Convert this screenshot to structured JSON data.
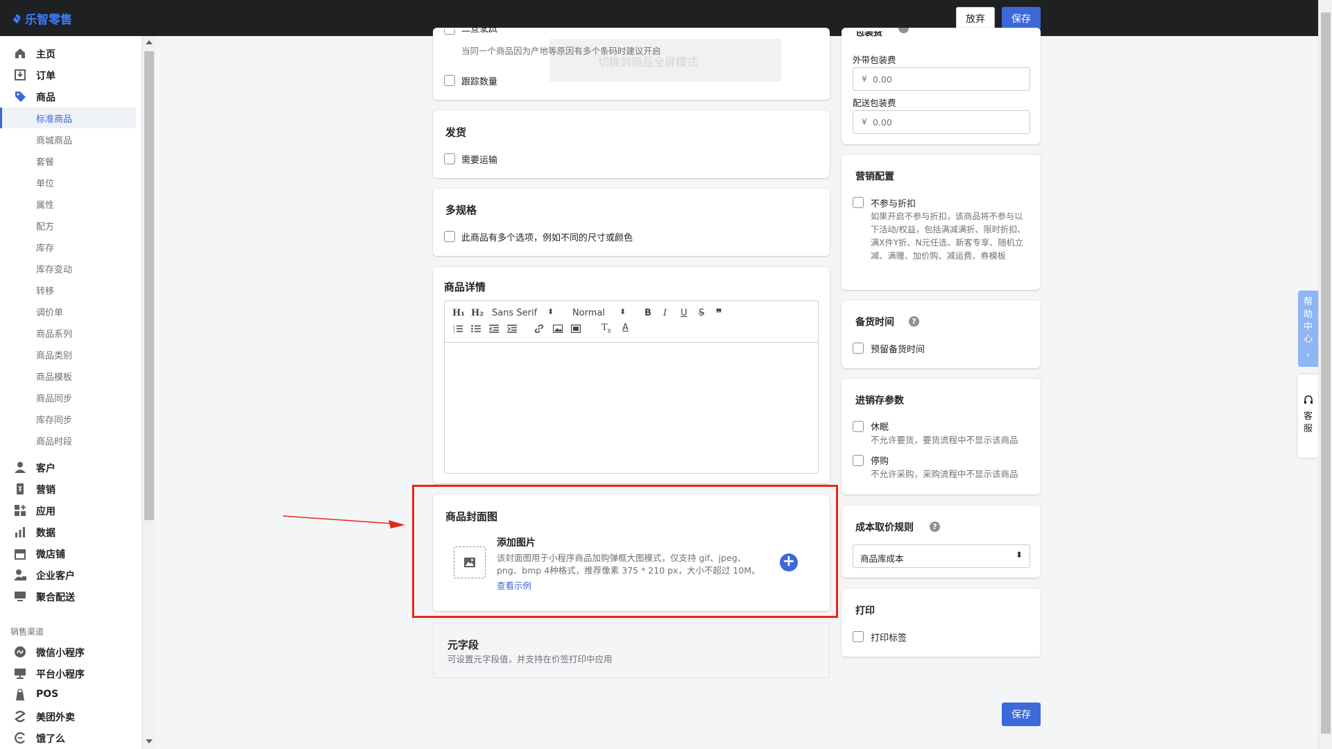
{
  "app": {
    "name": "乐智零售"
  },
  "topbar": {
    "discard_label": "放弃",
    "save_label": "保存"
  },
  "sidebar": {
    "items": [
      {
        "label": "主页",
        "icon": "home-icon"
      },
      {
        "label": "订单",
        "icon": "order-icon"
      },
      {
        "label": "商品",
        "icon": "tag-icon"
      }
    ],
    "product_sub": [
      "标准商品",
      "商城商品",
      "套餐",
      "单位",
      "属性",
      "配方",
      "库存",
      "库存变动",
      "转移",
      "调价单",
      "商品系列",
      "商品类别",
      "商品模板",
      "商品同步",
      "库存同步",
      "商品时段"
    ],
    "active_sub": "标准商品",
    "items2": [
      {
        "label": "客户",
        "icon": "customer-icon"
      },
      {
        "label": "营销",
        "icon": "marketing-icon"
      },
      {
        "label": "应用",
        "icon": "apps-icon"
      },
      {
        "label": "数据",
        "icon": "chart-icon"
      },
      {
        "label": "微店铺",
        "icon": "store-icon"
      },
      {
        "label": "企业客户",
        "icon": "enterprise-icon"
      },
      {
        "label": "聚合配送",
        "icon": "delivery-icon"
      }
    ],
    "channels_title": "销售渠道",
    "channels": [
      {
        "label": "微信小程序",
        "icon": "wechat-miniprogram-icon"
      },
      {
        "label": "平台小程序",
        "icon": "platform-icon"
      },
      {
        "label": "POS",
        "icon": "pos-icon"
      },
      {
        "label": "美团外卖",
        "icon": "meituan-icon"
      },
      {
        "label": "饿了么",
        "icon": "eleme-icon"
      }
    ]
  },
  "inventory_card": {
    "partial_label": "一品多码",
    "partial_help": "当同一个商品因为产地等原因有多个条码时建议开启",
    "track_label": "跟踪数量",
    "overlay_text": "切换到商品全屏模式"
  },
  "shipping_card": {
    "title": "发货",
    "needs_shipping": "需要运输"
  },
  "variants_card": {
    "title": "多规格",
    "has_options": "此商品有多个选项，例如不同的尺寸或颜色"
  },
  "details_card": {
    "title": "商品详情",
    "font_select": "Sans Serif",
    "size_select": "Normal"
  },
  "cover_card": {
    "title": "商品封面图",
    "add_image": "添加图片",
    "desc_line1": "该封面图用于小程序商品加购弹框大图模式，仅支持 gif、jpeg、",
    "desc_line2": "png、bmp 4种格式，推荐像素 375 * 210 px，大小不超过 10M。",
    "example_link": "查看示例"
  },
  "meta_card": {
    "title": "元字段",
    "desc": "可设置元字段值，并支持在价签打印中应用"
  },
  "packaging_card": {
    "title": "包装费",
    "takeaway_label": "外带包装费",
    "takeaway_value": "0.00",
    "delivery_label": "配送包装费",
    "delivery_value": "0.00",
    "currency": "¥"
  },
  "marketing_card": {
    "title": "营销配置",
    "no_discount": "不参与折扣",
    "desc": "如果开启不参与折扣，该商品将不参与以下活动/权益，包括满减满折、限时折扣、满X件Y折、N元任选、新客专享、随机立减、满赠、加价购、减运费、券模板"
  },
  "stock_time_card": {
    "title": "备货时间",
    "reserve": "预留备货时间"
  },
  "psi_card": {
    "title": "进销存参数",
    "dormant": "休眠",
    "dormant_desc": "不允许要货，要货流程中不显示该商品",
    "stop_purchase": "停购",
    "stop_desc": "不允许采购，采购流程中不显示该商品"
  },
  "cost_card": {
    "title": "成本取价规则",
    "selected": "商品库成本"
  },
  "print_card": {
    "title": "打印",
    "print_label": "打印标签"
  },
  "bottom": {
    "save_label": "保存"
  },
  "float": {
    "help": "帮助中心",
    "service": "客服"
  },
  "colors": {
    "accent": "#3d68d8",
    "topbar": "#1f2022",
    "highlight": "#e8261c"
  }
}
